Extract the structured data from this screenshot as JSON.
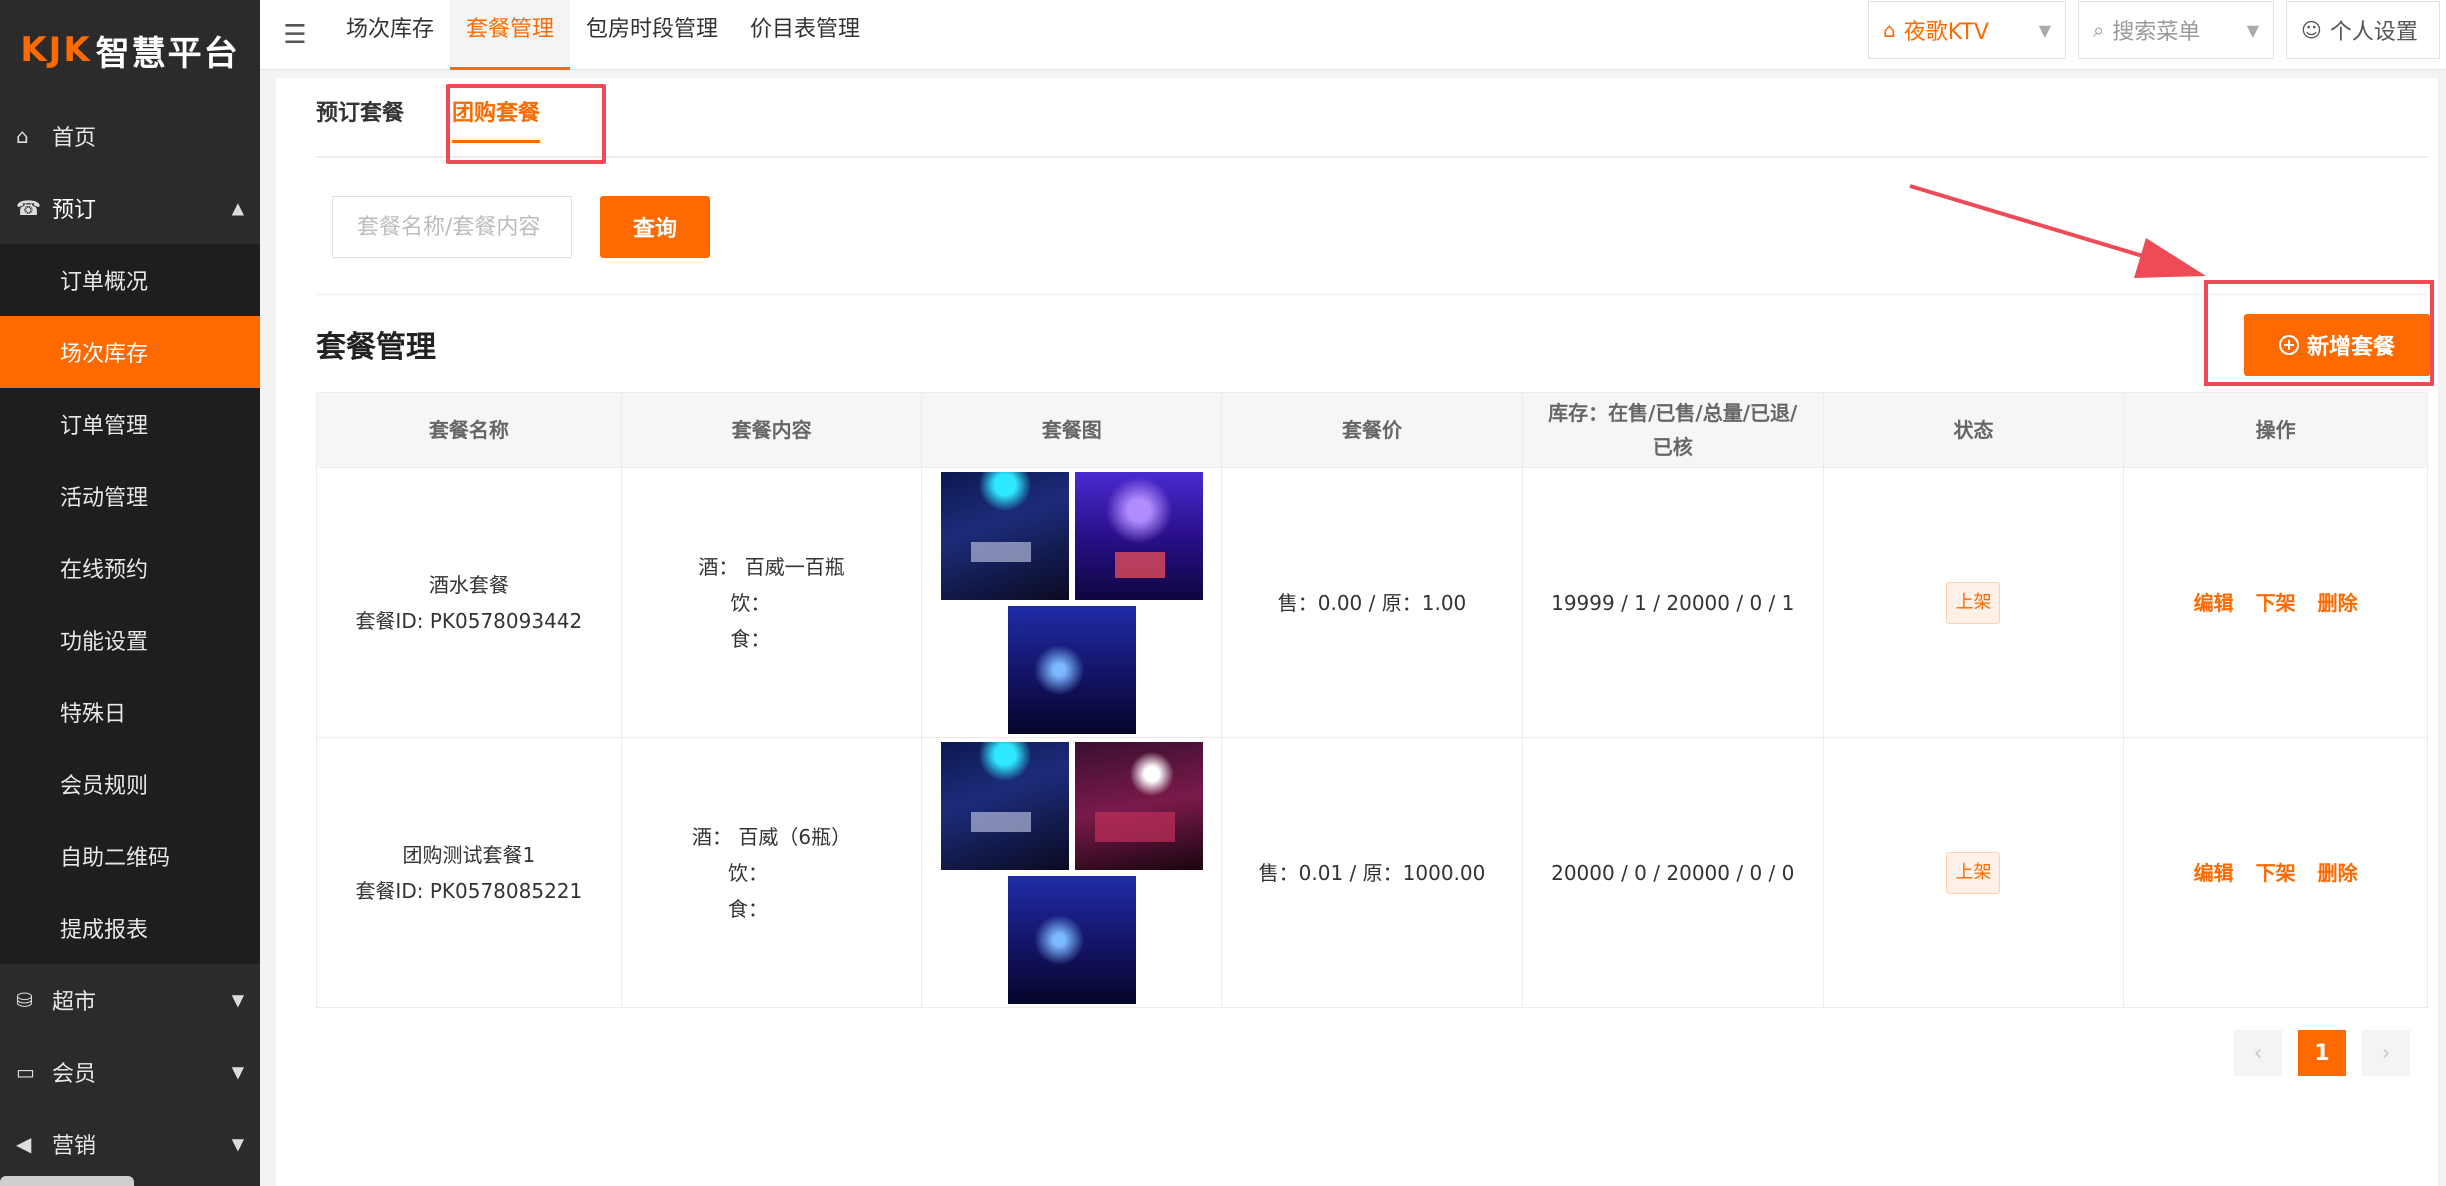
{
  "logo": {
    "brand": "KJK",
    "name": "智慧平台"
  },
  "sidebar": {
    "items": [
      {
        "label": "首页",
        "icon": "home-icon"
      },
      {
        "label": "预订",
        "icon": "bell-icon"
      },
      {
        "label": "订单概况"
      },
      {
        "label": "场次库存"
      },
      {
        "label": "订单管理"
      },
      {
        "label": "活动管理"
      },
      {
        "label": "在线预约"
      },
      {
        "label": "功能设置"
      },
      {
        "label": "特殊日"
      },
      {
        "label": "会员规则"
      },
      {
        "label": "自助二维码"
      },
      {
        "label": "提成报表"
      },
      {
        "label": "超市",
        "icon": "basket-icon"
      },
      {
        "label": "会员",
        "icon": "card-icon"
      },
      {
        "label": "营销",
        "icon": "megaphone-icon"
      }
    ]
  },
  "topbar": {
    "tabs": [
      "场次库存",
      "套餐管理",
      "包房时段管理",
      "价目表管理"
    ],
    "store": "夜歌KTV",
    "search_placeholder": "搜索菜单",
    "user": "个人设置"
  },
  "subtabs": [
    "预订套餐",
    "团购套餐"
  ],
  "search": {
    "placeholder": "套餐名称/套餐内容",
    "button": "查询"
  },
  "section": {
    "title": "套餐管理",
    "add_button": "新增套餐"
  },
  "table": {
    "headers": [
      "套餐名称",
      "套餐内容",
      "套餐图",
      "套餐价",
      "库存：在售/已售/总量/已退/",
      "已核",
      "状态",
      "操作"
    ],
    "rows": [
      {
        "name": "酒水套餐",
        "id": "套餐ID: PK0578093442",
        "drink": "酒：  百威一百瓶",
        "beverage": "饮：",
        "food": "食：",
        "price": "售：0.00 / 原：1.00",
        "stock": "19999 / 1 / 20000 / 0 / 1",
        "status": "上架"
      },
      {
        "name": "团购测试套餐1",
        "id": "套餐ID: PK0578085221",
        "drink": "酒：  百威（6瓶）",
        "beverage": "饮：",
        "food": "食：",
        "price": "售：0.01 / 原：1000.00",
        "stock": "20000 / 0 / 20000 / 0 / 0",
        "status": "上架"
      }
    ],
    "ops": [
      "编辑",
      "下架",
      "删除"
    ]
  },
  "pager": {
    "prev": "‹",
    "current": "1",
    "next": "›"
  },
  "colors": {
    "accent": "#ff6a00",
    "annotation": "#ef4b57",
    "sidebar": "#2b2b2b"
  }
}
